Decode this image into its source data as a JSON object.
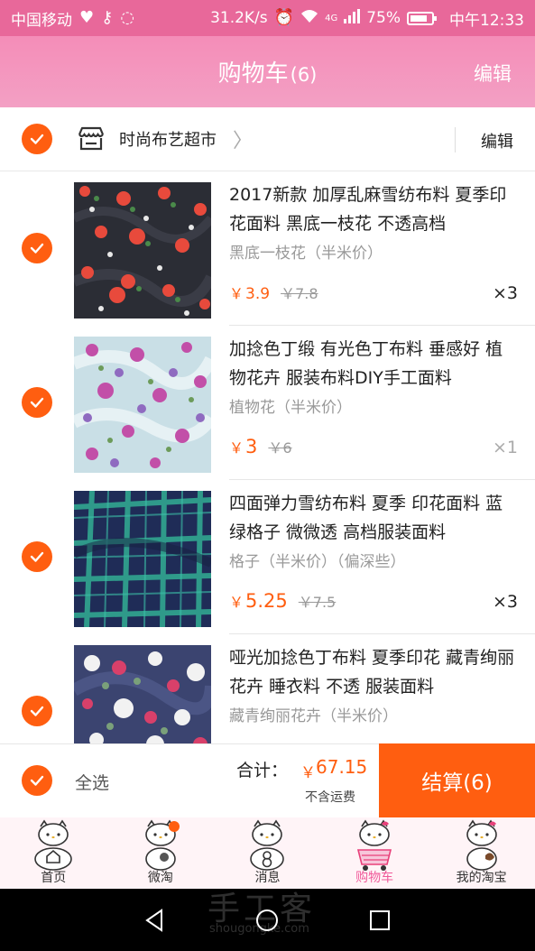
{
  "status_bar": {
    "carrier": "中国移动",
    "speed": "31.2K/s",
    "network": "4G",
    "battery": "75%",
    "time": "中午12:33",
    "icons": [
      "heart-icon",
      "key-icon",
      "sync-icon",
      "alarm-icon",
      "wifi-icon",
      "signal-icon",
      "battery-icon"
    ]
  },
  "header": {
    "title": "购物车",
    "count": "(6)",
    "edit_label": "编辑"
  },
  "shop": {
    "name": "时尚布艺超市",
    "edit_label": "编辑",
    "icon": "store-icon"
  },
  "items": [
    {
      "title": "2017新款 加厚乱麻雪纺布料 夏季印花面料 黑底一枝花 不透高档",
      "variant": "黑底一枝花（半米价）",
      "currency": "￥",
      "price": "3.9",
      "original_price": "￥7.8",
      "quantity": "×3",
      "checked": true
    },
    {
      "title": "加捻色丁缎 有光色丁布料 垂感好 植物花卉 服装布料DIY手工面料",
      "variant": "植物花（半米价）",
      "currency": "￥",
      "price": "3",
      "original_price": "￥6",
      "quantity": "×1",
      "checked": true
    },
    {
      "title": "四面弹力雪纺布料 夏季 印花面料 蓝绿格子 微微透 高档服装面料",
      "variant": "格子（半米价）（偏深些）",
      "currency": "￥",
      "price": "5.25",
      "original_price": "￥7.5",
      "quantity": "×3",
      "checked": true
    },
    {
      "title": "哑光加捻色丁布料 夏季印花 藏青绚丽花卉 睡衣料 不透 服装面料",
      "variant": "藏青绚丽花卉（半米价）",
      "currency": "￥",
      "price": "",
      "original_price": "",
      "quantity": "",
      "checked": true
    }
  ],
  "checkout": {
    "select_all_label": "全选",
    "total_label": "合计：",
    "currency": "￥",
    "total_value": "67.15",
    "shipping_note": "不含运费",
    "settle_label": "结算(6)"
  },
  "tabs": [
    {
      "label": "首页",
      "icon": "hello-kitty-home-icon",
      "active": false
    },
    {
      "label": "微淘",
      "icon": "hello-kitty-weitao-icon",
      "active": false,
      "badge": true
    },
    {
      "label": "消息",
      "icon": "hello-kitty-message-icon",
      "active": false
    },
    {
      "label": "购物车",
      "icon": "hello-kitty-cart-icon",
      "active": true
    },
    {
      "label": "我的淘宝",
      "icon": "hello-kitty-profile-icon",
      "active": false
    }
  ],
  "watermark": {
    "text": "手工客",
    "sub": "shougongke.com"
  },
  "colors": {
    "accent": "#ff5e10",
    "header_pink": "#f48db8",
    "status_pink": "#e8689a",
    "tab_active": "#f05a9a"
  }
}
